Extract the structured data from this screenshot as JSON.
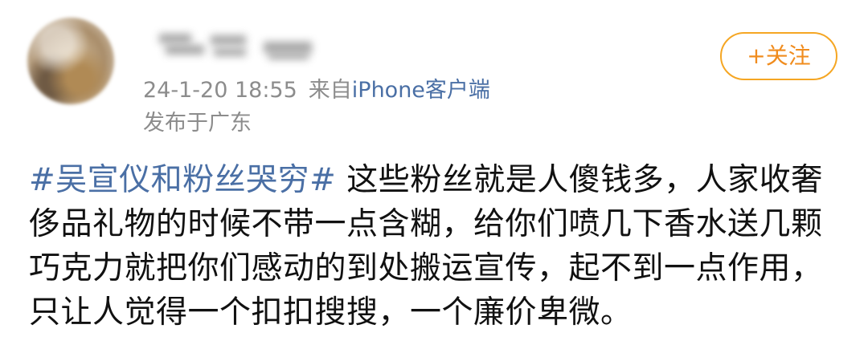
{
  "author": {
    "name_blurred": true
  },
  "post_meta": {
    "timestamp": "24-1-20 18:55",
    "source_prefix": "来自",
    "client": "iPhone客户端",
    "location_label": "发布于",
    "location": "广东"
  },
  "follow_button": {
    "label": "+关注"
  },
  "post": {
    "hashtag": "#吴宣仪和粉丝哭穷#",
    "text": " 这些粉丝就是人傻钱多，人家收奢侈品礼物的时候不带一点含糊，给你们喷几下香水送几颗巧克力就把你们感动的到处搬运宣传，起不到一点作用，只让人觉得一个扣扣搜搜，一个廉价卑微。"
  },
  "colors": {
    "link_blue": "#4a6fa5",
    "meta_gray": "#8c8c8c",
    "follow_orange": "#f08c1e",
    "follow_border": "#f5a623",
    "text_dark": "#111111"
  }
}
